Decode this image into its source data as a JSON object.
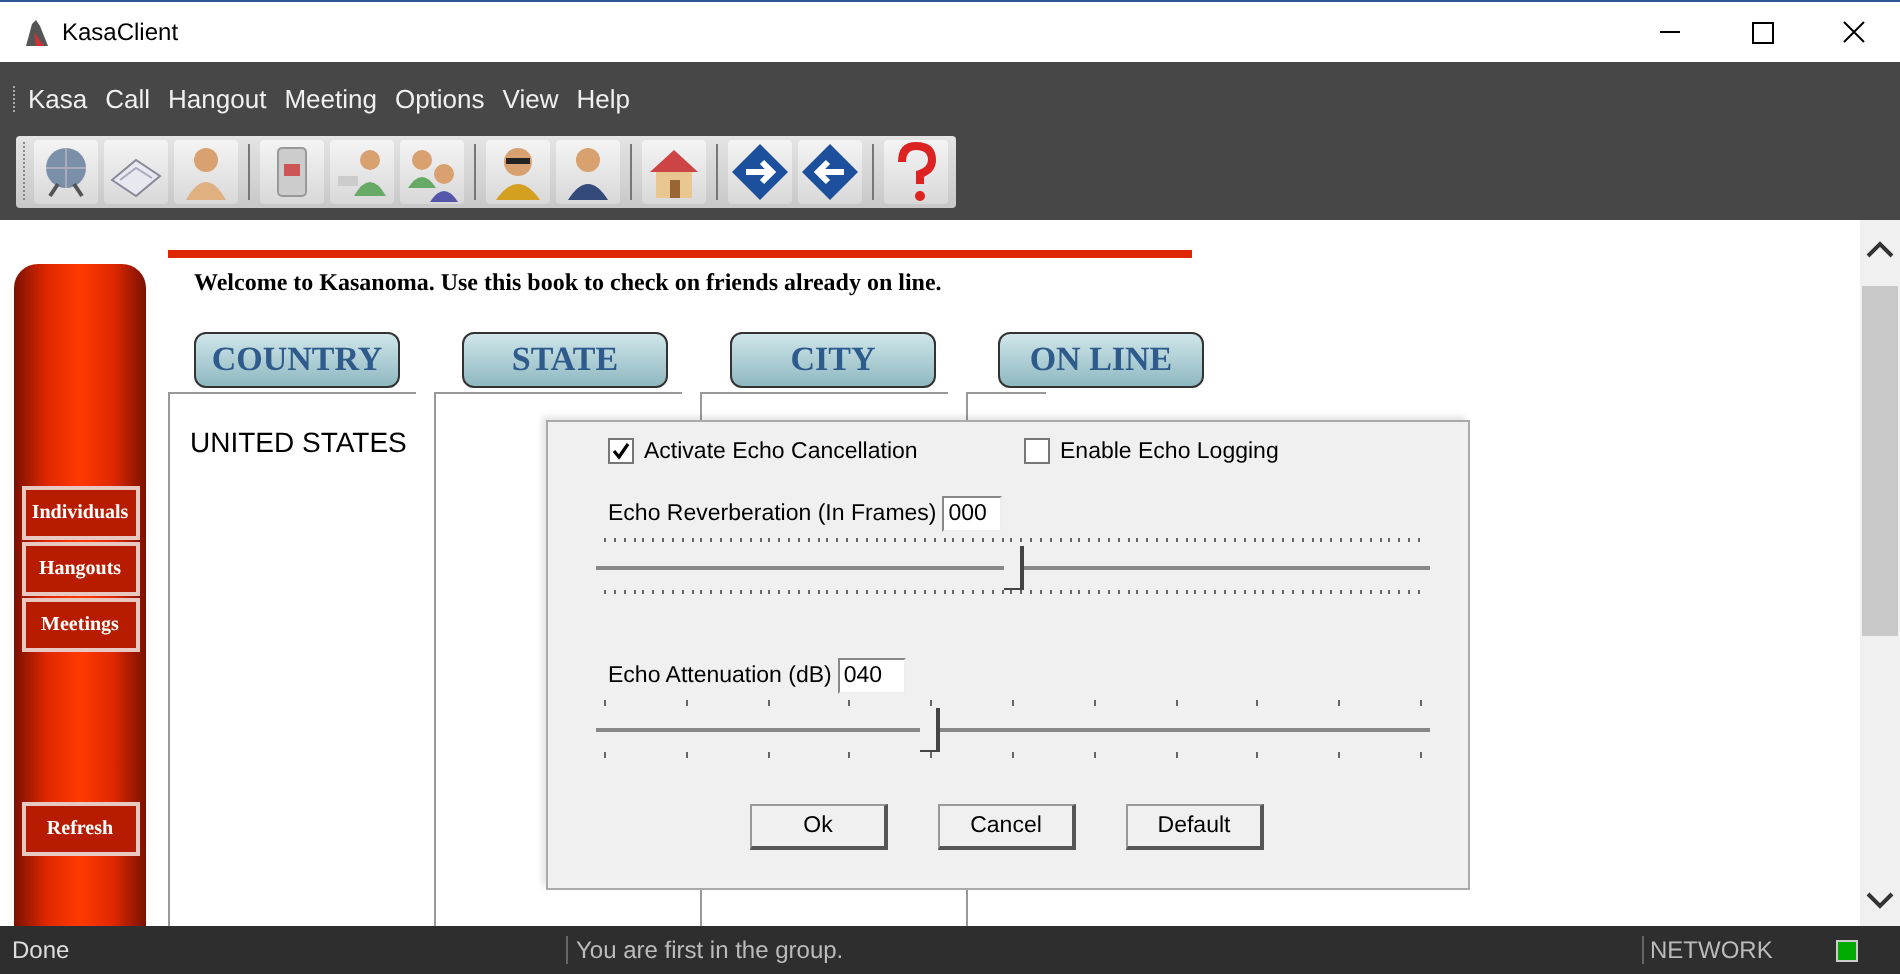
{
  "window": {
    "title": "KasaClient"
  },
  "menu": [
    "Kasa",
    "Call",
    "Hangout",
    "Meeting",
    "Options",
    "View",
    "Help"
  ],
  "sidebar": {
    "items": [
      {
        "label": "Individuals",
        "kind": "top"
      },
      {
        "label": "Hangouts",
        "kind": "top"
      },
      {
        "label": "Meetings",
        "kind": "top"
      },
      {
        "label": "Refresh",
        "kind": "bottom"
      }
    ]
  },
  "welcome": "Welcome to Kasanoma. Use this book to check on friends already on line.",
  "columns": [
    {
      "heading": "COUNTRY",
      "entries": [
        "UNITED STATES"
      ]
    },
    {
      "heading": "STATE"
    },
    {
      "heading": "CITY"
    },
    {
      "heading": "ON LINE"
    }
  ],
  "dialog": {
    "checkboxes": [
      {
        "label": "Activate Echo Cancellation",
        "checked": true
      },
      {
        "label": "Enable Echo Logging",
        "checked": false
      }
    ],
    "sliders": [
      {
        "label": "Echo Reverberation (In Frames)",
        "value": "000",
        "level": 0.5,
        "kind": "fine"
      },
      {
        "label": "Echo Attenuation (dB)",
        "value": "040",
        "level": 0.4,
        "kind": "coarse"
      }
    ],
    "buttons": [
      "Ok",
      "Cancel",
      "Default"
    ]
  },
  "status_bar": {
    "message": "Done",
    "group": "You are first in the group.",
    "network": "NETWORK",
    "network_on": true
  }
}
